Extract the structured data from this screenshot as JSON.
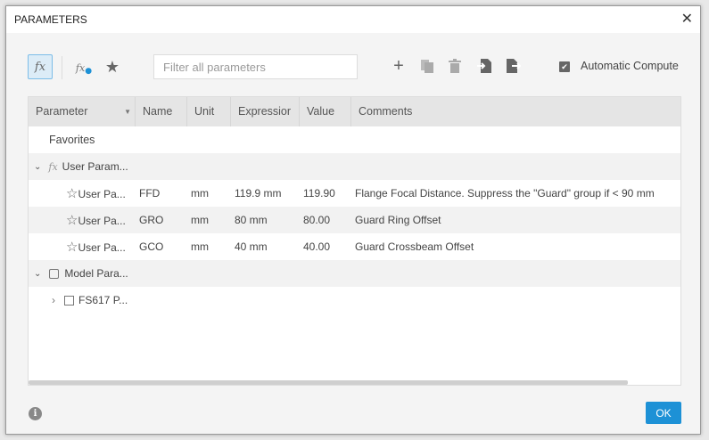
{
  "dialog": {
    "title": "PARAMETERS",
    "close": "✕"
  },
  "toolbar": {
    "fx_label": "fx",
    "user_fx_label": "fx",
    "favorites_icon": "★",
    "filter_placeholder": "Filter all parameters",
    "add": "+",
    "auto_compute_label": "Automatic Compute",
    "auto_compute_checked": true
  },
  "table": {
    "columns": [
      "Parameter",
      "Name",
      "Unit",
      "Expressior",
      "Value",
      "Comments"
    ],
    "favorites": "Favorites",
    "user_group": "User Param...",
    "rows": [
      {
        "param": "User Pa...",
        "name": "FFD",
        "unit": "mm",
        "expression": "119.9 mm",
        "value": "119.90",
        "comment": "Flange Focal Distance. Suppress the \"Guard\" group if < 90 mm"
      },
      {
        "param": "User Pa...",
        "name": "GRO",
        "unit": "mm",
        "expression": "80 mm",
        "value": "80.00",
        "comment": "Guard Ring Offset"
      },
      {
        "param": "User Pa...",
        "name": "GCO",
        "unit": "mm",
        "expression": "40 mm",
        "value": "40.00",
        "comment": "Guard Crossbeam Offset"
      }
    ],
    "model_group": "Model Para...",
    "model_child": "FS617 P..."
  },
  "footer": {
    "ok": "OK",
    "info": "i"
  },
  "colors": {
    "accent": "#1d91d6"
  }
}
